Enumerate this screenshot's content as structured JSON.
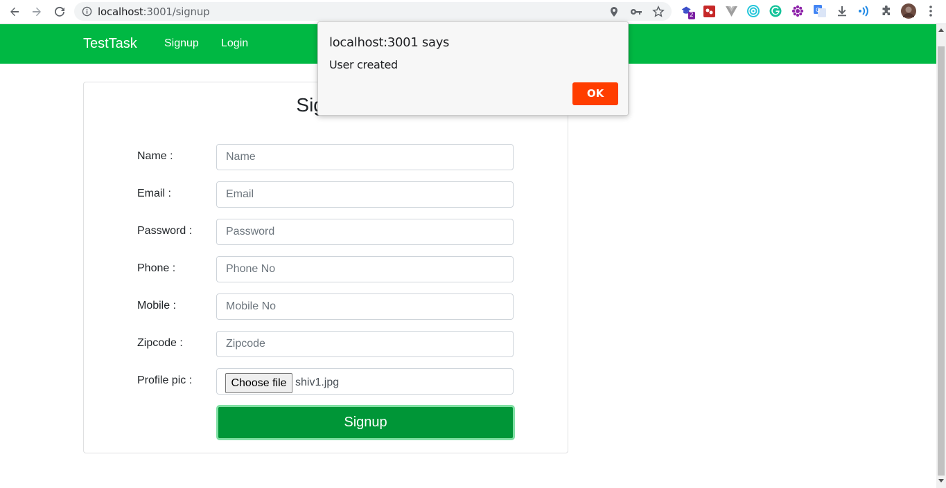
{
  "browser": {
    "url_host": "localhost",
    "url_path": ":3001/signup",
    "extension_badge": "2"
  },
  "navbar": {
    "brand": "TestTask",
    "links": [
      "Signup",
      "Login"
    ]
  },
  "form": {
    "title": "Signup",
    "fields": [
      {
        "label": "Name :",
        "placeholder": "Name"
      },
      {
        "label": "Email :",
        "placeholder": "Email"
      },
      {
        "label": "Password :",
        "placeholder": "Password"
      },
      {
        "label": "Phone :",
        "placeholder": "Phone No"
      },
      {
        "label": "Mobile :",
        "placeholder": "Mobile No"
      },
      {
        "label": "Zipcode :",
        "placeholder": "Zipcode"
      }
    ],
    "file": {
      "label": "Profile pic :",
      "button": "Choose file",
      "filename": "shiv1.jpg"
    },
    "submit_label": "Signup"
  },
  "dialog": {
    "title": "localhost:3001 says",
    "message": "User created",
    "ok_label": "OK"
  },
  "colors": {
    "navbar": "#00b843",
    "submit": "#009637",
    "dialog_ok": "#ff3d00"
  }
}
